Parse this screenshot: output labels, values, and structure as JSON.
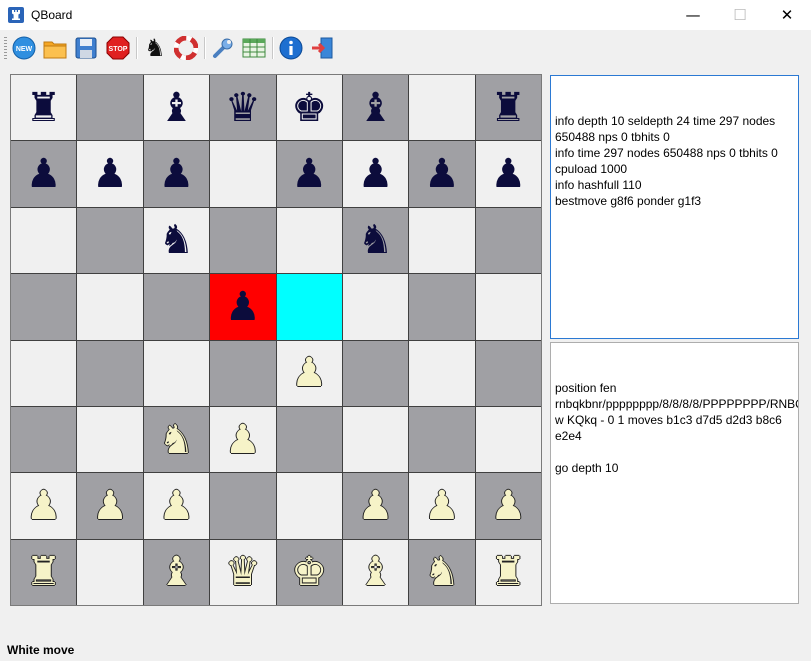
{
  "window": {
    "title": "QBoard",
    "minimize": "—",
    "maximize": "☐",
    "close": "✕"
  },
  "toolbar": {
    "buttons": [
      {
        "name": "new-game-button",
        "icon": "new-icon",
        "label": "NEW"
      },
      {
        "name": "open-button",
        "icon": "folder-icon"
      },
      {
        "name": "save-button",
        "icon": "floppy-icon"
      },
      {
        "name": "stop-button",
        "icon": "stop-icon",
        "label": "STOP"
      },
      {
        "name": "engine-button",
        "icon": "knight-icon"
      },
      {
        "name": "help-ring-button",
        "icon": "lifebuoy-icon"
      },
      {
        "name": "settings-button",
        "icon": "wrench-icon"
      },
      {
        "name": "table-button",
        "icon": "table-icon"
      },
      {
        "name": "info-button",
        "icon": "info-icon"
      },
      {
        "name": "exit-button",
        "icon": "exit-icon"
      }
    ]
  },
  "board": {
    "rows": [
      [
        "br",
        "",
        "bb",
        "bq",
        "bk",
        "bb",
        "",
        "br"
      ],
      [
        "bp",
        "bp",
        "bp",
        "",
        "bp",
        "bp",
        "bp",
        "bp"
      ],
      [
        "",
        "",
        "bn",
        "",
        "",
        "bn",
        "",
        ""
      ],
      [
        "",
        "",
        "",
        "bp",
        "",
        "",
        "",
        ""
      ],
      [
        "",
        "",
        "",
        "",
        "wp",
        "",
        "",
        ""
      ],
      [
        "",
        "",
        "wn",
        "wp",
        "",
        "",
        "",
        ""
      ],
      [
        "wp",
        "wp",
        "wp",
        "",
        "",
        "wp",
        "wp",
        "wp"
      ],
      [
        "wr",
        "",
        "wb",
        "wq",
        "wk",
        "wb",
        "wn",
        "wr"
      ]
    ],
    "highlight_from": "d5",
    "highlight_to": "e5",
    "colors": {
      "light": "#f0f0f0",
      "dark": "#a0a0a4",
      "from": "#ff0000",
      "to": "#00ffff"
    }
  },
  "engine_output": [
    "info depth 10 seldepth 24 time 297 nodes 650488 nps 0 tbhits 0",
    "info time 297 nodes 650488 nps 0 tbhits 0 cpuload 1000",
    "info hashfull 110",
    "bestmove g8f6 ponder g1f3"
  ],
  "engine_input": [
    "position fen rnbqkbnr/pppppppp/8/8/8/8/PPPPPPPP/RNBQKBNR w KQkq - 0 1 moves b1c3 d7d5 d2d3 b8c6 e2e4",
    "",
    "go depth 10"
  ],
  "status": "White move"
}
